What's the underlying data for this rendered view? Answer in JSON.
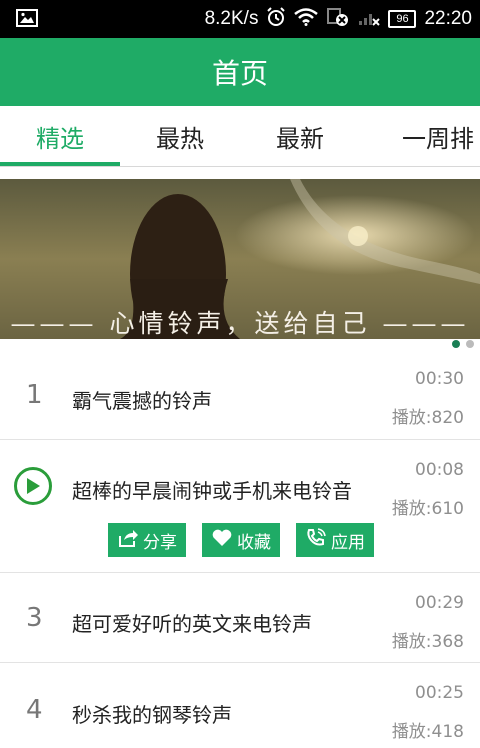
{
  "status_bar": {
    "speed": "8.2K/s",
    "battery": "96",
    "time": "22:20",
    "icons": [
      "image-icon",
      "alarm-icon",
      "wifi-icon",
      "data-off-icon",
      "signal-icon",
      "battery-icon"
    ]
  },
  "header": {
    "title": "首页"
  },
  "tabs": [
    {
      "label": "精选",
      "active": true
    },
    {
      "label": "最热",
      "active": false
    },
    {
      "label": "最新",
      "active": false
    },
    {
      "label": "一周排",
      "active": false
    }
  ],
  "banner": {
    "caption": "——— 心情铃声，送给自己 ———",
    "page_count": 2,
    "current_page": 1
  },
  "songs": [
    {
      "number": "1",
      "title": "霸气震撼的铃声",
      "duration": "00:30",
      "plays": "播放:820"
    },
    {
      "number": "",
      "title": "超棒的早晨闹钟或手机来电铃音",
      "duration": "00:08",
      "plays": "播放:610",
      "playing": true
    },
    {
      "number": "3",
      "title": "超可爱好听的英文来电铃声",
      "duration": "00:29",
      "plays": "播放:368"
    },
    {
      "number": "4",
      "title": "秒杀我的钢琴铃声",
      "duration": "00:25",
      "plays": "播放:418"
    }
  ],
  "actions": [
    {
      "label": "分享",
      "icon": "share-icon"
    },
    {
      "label": "收藏",
      "icon": "heart-icon"
    },
    {
      "label": "应用",
      "icon": "phone-icon"
    }
  ],
  "colors": {
    "accent": "#1fab66",
    "play": "#2a9d3a"
  }
}
